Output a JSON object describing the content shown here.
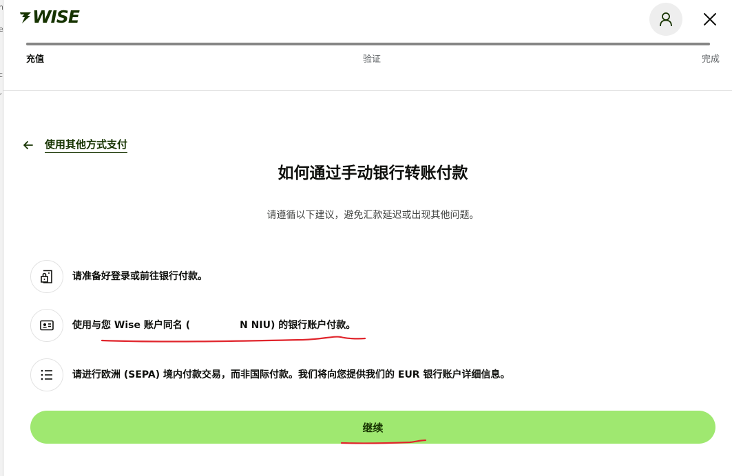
{
  "brand": {
    "name": "WISE",
    "color": "#163300",
    "accent": "#9fe870"
  },
  "header": {
    "avatar_icon": "user-icon",
    "close_icon": "close-icon",
    "progress": {
      "value_percent": 100,
      "track_color": "#c9c9c9",
      "fill_color": "#868685"
    },
    "steps": [
      {
        "label": "充值",
        "state": "active"
      },
      {
        "label": "验证",
        "state": "upcoming"
      },
      {
        "label": "完成",
        "state": "upcoming"
      }
    ]
  },
  "back_link": {
    "label": "使用其他方式支付",
    "icon": "arrow-left-icon"
  },
  "title": "如何通过手动银行转账付款",
  "subtitle": "请遵循以下建议，避免汇款延迟或出现其他问题。",
  "tips": [
    {
      "icon": "bank-login-icon",
      "text": "请准备好登录或前往银行付款。"
    },
    {
      "icon": "id-card-icon",
      "text_before": "使用与您 Wise 账户同名 (",
      "text_after": "N NIU) 的银行账户付款。"
    },
    {
      "icon": "list-icon",
      "text": "请进行欧洲 (SEPA) 境内付款交易，而非国际付款。我们将向您提供我们的 EUR 银行账户详细信息。"
    }
  ],
  "primary_button": {
    "label": "继续",
    "color": "#9fe870"
  },
  "annotations": {
    "underline_color": "#e0242b"
  },
  "background_page": {
    "edge_chars": [
      "n",
      "e",
      "c",
      "r"
    ]
  }
}
